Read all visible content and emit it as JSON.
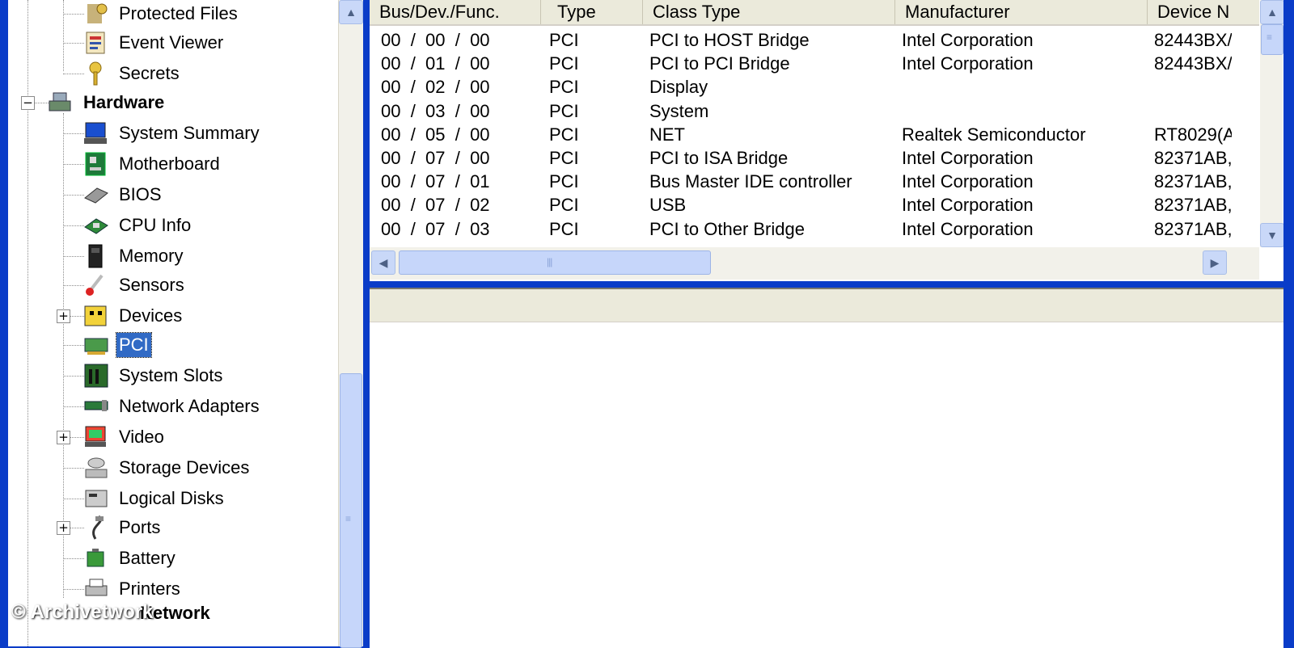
{
  "tree": {
    "items": [
      {
        "label": "Protected Files",
        "icon": "shield-key-icon",
        "bold": false,
        "selected": false
      },
      {
        "label": "Event Viewer",
        "icon": "event-viewer-icon",
        "bold": false,
        "selected": false
      },
      {
        "label": "Secrets",
        "icon": "key-icon",
        "bold": false,
        "selected": false
      },
      {
        "label": "Hardware",
        "icon": "hardware-icon",
        "bold": true,
        "selected": false
      },
      {
        "label": "System Summary",
        "icon": "monitor-icon",
        "bold": false,
        "selected": false
      },
      {
        "label": "Motherboard",
        "icon": "motherboard-icon",
        "bold": false,
        "selected": false
      },
      {
        "label": "BIOS",
        "icon": "bios-chip-icon",
        "bold": false,
        "selected": false
      },
      {
        "label": "CPU Info",
        "icon": "cpu-icon",
        "bold": false,
        "selected": false
      },
      {
        "label": "Memory",
        "icon": "memory-icon",
        "bold": false,
        "selected": false
      },
      {
        "label": "Sensors",
        "icon": "thermometer-icon",
        "bold": false,
        "selected": false
      },
      {
        "label": "Devices",
        "icon": "devices-icon",
        "bold": false,
        "selected": false
      },
      {
        "label": "PCI",
        "icon": "pci-card-icon",
        "bold": false,
        "selected": true
      },
      {
        "label": "System Slots",
        "icon": "slot-icon",
        "bold": false,
        "selected": false
      },
      {
        "label": "Network Adapters",
        "icon": "network-card-icon",
        "bold": false,
        "selected": false
      },
      {
        "label": "Video",
        "icon": "video-monitor-icon",
        "bold": false,
        "selected": false
      },
      {
        "label": "Storage Devices",
        "icon": "disk-drive-icon",
        "bold": false,
        "selected": false
      },
      {
        "label": "Logical Disks",
        "icon": "logical-disk-icon",
        "bold": false,
        "selected": false
      },
      {
        "label": "Ports",
        "icon": "port-cable-icon",
        "bold": false,
        "selected": false
      },
      {
        "label": "Battery",
        "icon": "battery-icon",
        "bold": false,
        "selected": false
      },
      {
        "label": "Printers",
        "icon": "printer-icon",
        "bold": false,
        "selected": false
      }
    ],
    "partial_item": "Network"
  },
  "list": {
    "columns": [
      "Bus/Dev./Func.",
      "Type",
      "Class Type",
      "Manufacturer",
      "Device N"
    ],
    "rows": [
      [
        "00  /  00  /  00",
        "PCI",
        "PCI to HOST Bridge",
        "Intel Corporation",
        "82443BX/"
      ],
      [
        "00  /  01  /  00",
        "PCI",
        "PCI to PCI Bridge",
        "Intel Corporation",
        "82443BX/"
      ],
      [
        "00  /  02  /  00",
        "PCI",
        "Display",
        "",
        ""
      ],
      [
        "00  /  03  /  00",
        "PCI",
        "System",
        "",
        ""
      ],
      [
        "00  /  05  /  00",
        "PCI",
        "NET",
        "Realtek Semiconductor",
        "RT8029(A"
      ],
      [
        "00  /  07  /  00",
        "PCI",
        "PCI to ISA Bridge",
        "Intel Corporation",
        "82371AB,"
      ],
      [
        "00  /  07  /  01",
        "PCI",
        "Bus Master IDE controller",
        "Intel Corporation",
        "82371AB,"
      ],
      [
        "00  /  07  /  02",
        "PCI",
        "USB",
        "Intel Corporation",
        "82371AB,"
      ],
      [
        "00  /  07  /  03",
        "PCI",
        "PCI to Other Bridge",
        "Intel Corporation",
        "82371AB,"
      ]
    ]
  },
  "watermark": "© Archivetwork",
  "colors": {
    "selection": "#316ac5",
    "frame": "#0a3cc8",
    "header_bg": "#ebeadb"
  }
}
